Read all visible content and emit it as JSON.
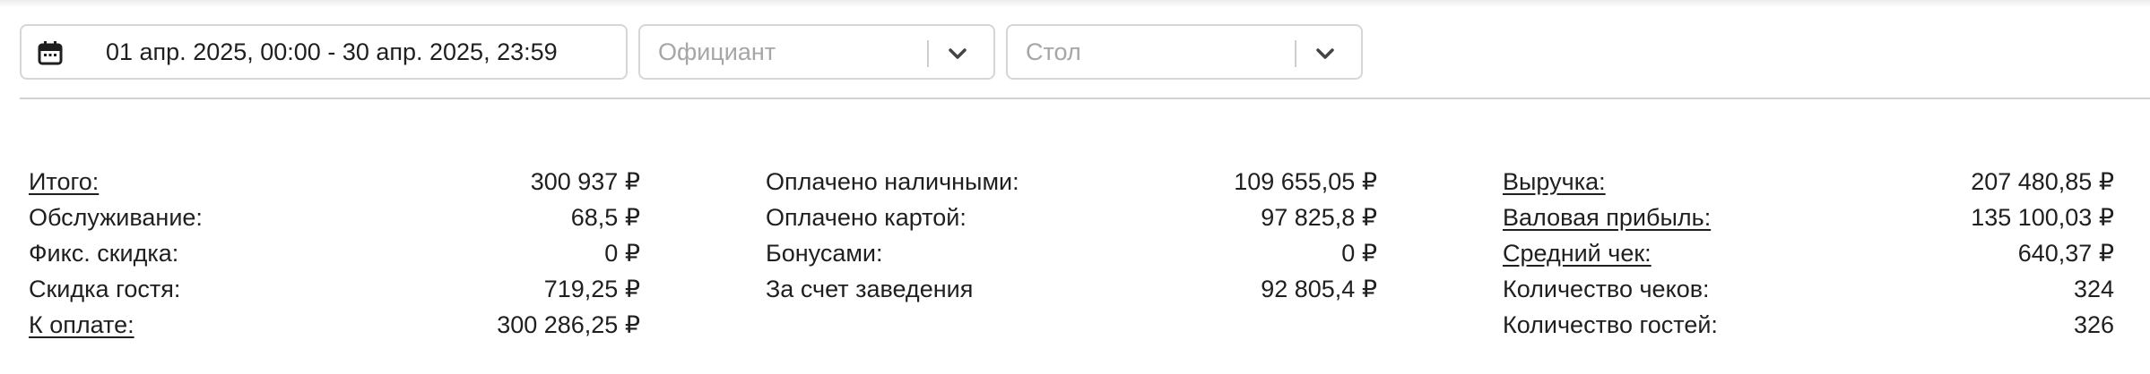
{
  "filters": {
    "date_range": "01 апр. 2025, 00:00 - 30 апр. 2025, 23:59",
    "waiter_placeholder": "Официант",
    "table_placeholder": "Стол"
  },
  "summary": {
    "col1": [
      {
        "label": "Итого:",
        "value": "300 937 ₽"
      },
      {
        "label": "Обслуживание:",
        "value": "68,5 ₽"
      },
      {
        "label": "Фикс. скидка:",
        "value": "0 ₽"
      },
      {
        "label": "Скидка гостя:",
        "value": "719,25 ₽"
      },
      {
        "label": "К оплате:",
        "value": "300 286,25 ₽"
      }
    ],
    "col2": [
      {
        "label": "Оплачено наличными:",
        "value": "109 655,05 ₽"
      },
      {
        "label": "Оплачено картой:",
        "value": "97 825,8 ₽"
      },
      {
        "label": "Бонусами:",
        "value": "0 ₽"
      },
      {
        "label": "За счет заведения",
        "value": "92 805,4 ₽"
      }
    ],
    "col3": [
      {
        "label": "Выручка:",
        "value": "207 480,85 ₽"
      },
      {
        "label": "Валовая прибыль:",
        "value": "135 100,03 ₽"
      },
      {
        "label": "Средний чек:",
        "value": "640,37 ₽"
      },
      {
        "label": "Количество чеков:",
        "value": "324"
      },
      {
        "label": "Количество гостей:",
        "value": "326"
      }
    ]
  },
  "icons": {
    "calendar": "calendar-icon",
    "dropdown": "chevron-down-icon"
  }
}
